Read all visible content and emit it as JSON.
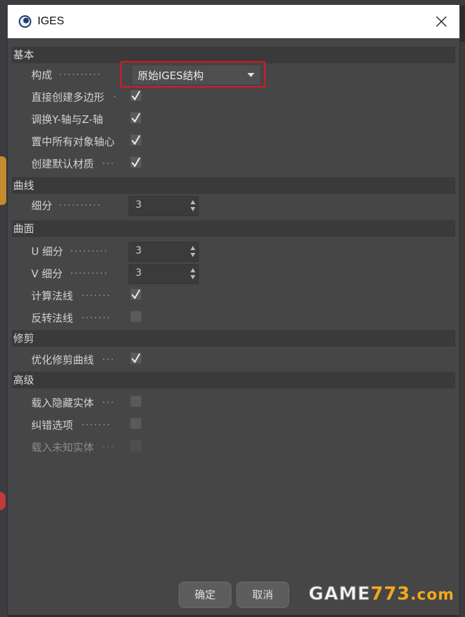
{
  "dialog": {
    "title": "IGES",
    "close_icon": "close-icon"
  },
  "sections": {
    "basic": {
      "header": "基本",
      "composition": {
        "label": "构成",
        "value": "原始IGES结构"
      },
      "direct_polygon": {
        "label": "直接创建多边形",
        "checked": true
      },
      "swap_yz": {
        "label": "调换Y-轴与Z-轴",
        "checked": true
      },
      "center_axes": {
        "label": "置中所有对象轴心",
        "checked": true
      },
      "default_material": {
        "label": "创建默认材质",
        "checked": true
      }
    },
    "curve": {
      "header": "曲线",
      "subdivision": {
        "label": "细分",
        "value": "3"
      }
    },
    "surface": {
      "header": "曲面",
      "u_subdivision": {
        "label": "U 细分",
        "value": "3"
      },
      "v_subdivision": {
        "label": "V 细分",
        "value": "3"
      },
      "calc_normals": {
        "label": "计算法线",
        "checked": true
      },
      "flip_normals": {
        "label": "反转法线",
        "checked": false
      }
    },
    "trim": {
      "header": "修剪",
      "optimize_trim": {
        "label": "优化修剪曲线",
        "checked": true
      }
    },
    "advanced": {
      "header": "高级",
      "load_hidden": {
        "label": "载入隐藏实体",
        "checked": false
      },
      "error_options": {
        "label": "纠错选项",
        "checked": false
      },
      "load_unknown": {
        "label": "载入未知实体",
        "checked": false,
        "disabled": true
      }
    }
  },
  "buttons": {
    "ok": "确定",
    "cancel": "取消"
  },
  "watermark": {
    "part1": "GAME",
    "part2": "773",
    "part3": ".com"
  },
  "colors": {
    "highlight_border": "#e0161e",
    "dialog_bg": "#464646",
    "section_bg": "#3a3a3a"
  }
}
